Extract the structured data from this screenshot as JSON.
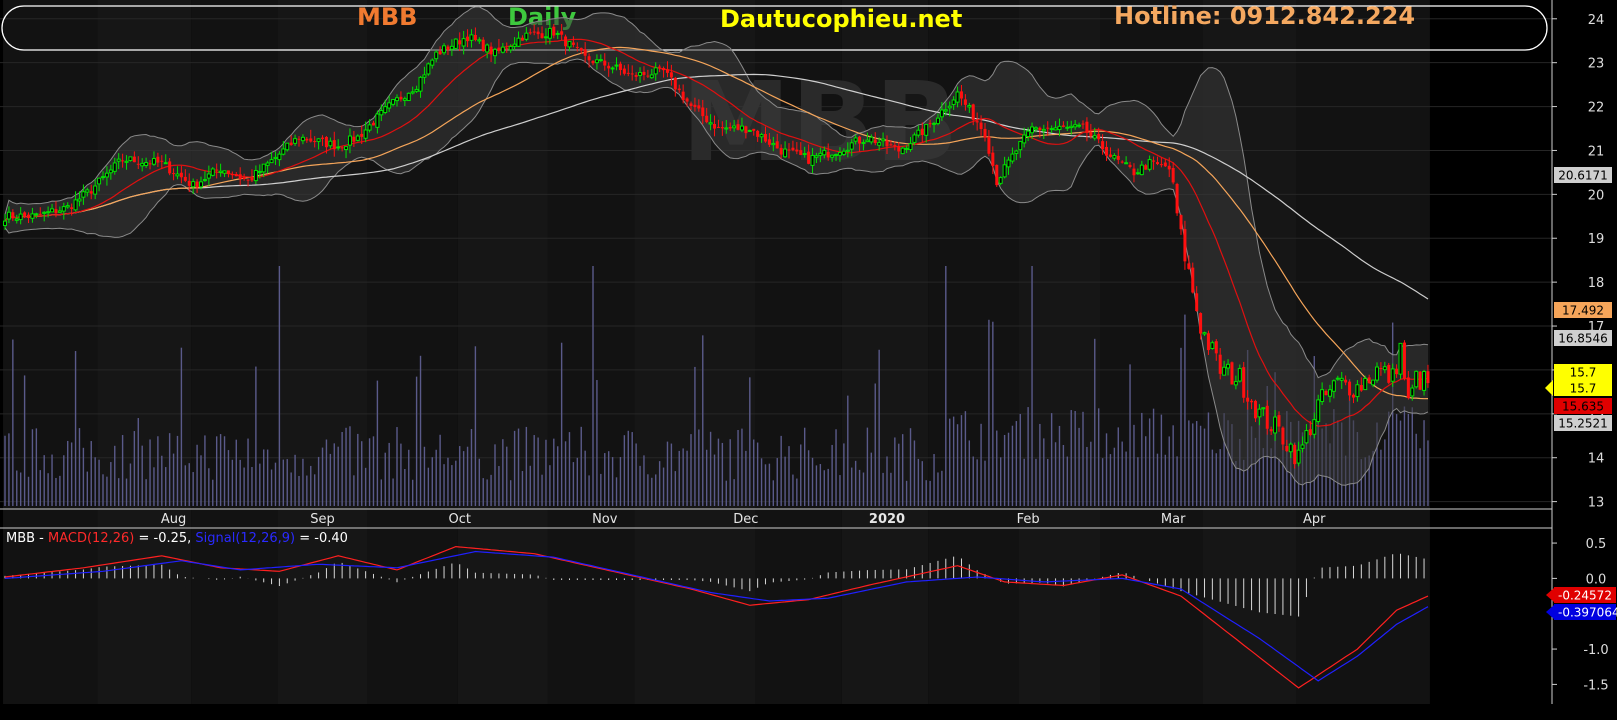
{
  "header": {
    "symbol": "MBB",
    "period": "Daily",
    "site": "Dautucophieu.net",
    "hotline": "Hotline: 0912.842.224",
    "colors": {
      "symbol": "#f07a30",
      "period": "#3ec83e",
      "site": "#ffff00",
      "hotline": "#f4a860"
    }
  },
  "watermark": "MBB",
  "chart_data": [
    {
      "type": "candlestick",
      "ylim": [
        12.9,
        24.2
      ],
      "yticks": [
        13,
        14,
        15,
        16,
        17,
        18,
        19,
        20,
        21,
        22,
        23,
        24
      ],
      "x_labels": [
        "Aug",
        "Sep",
        "Oct",
        "Nov",
        "Dec",
        "2020",
        "Feb",
        "Mar",
        "Apr"
      ],
      "grid": true,
      "price_path": [
        [
          0,
          19.5
        ],
        [
          8,
          19.5
        ],
        [
          16,
          19.7
        ],
        [
          22,
          20.1
        ],
        [
          30,
          20.8
        ],
        [
          40,
          20.7
        ],
        [
          48,
          20.2
        ],
        [
          55,
          20.6
        ],
        [
          62,
          20.3
        ],
        [
          75,
          21.3
        ],
        [
          85,
          21.1
        ],
        [
          90,
          21.3
        ],
        [
          98,
          22.0
        ],
        [
          105,
          22.5
        ],
        [
          110,
          23.2
        ],
        [
          118,
          23.6
        ],
        [
          125,
          23.2
        ],
        [
          132,
          23.6
        ],
        [
          140,
          23.7
        ],
        [
          148,
          23.1
        ],
        [
          155,
          22.9
        ],
        [
          160,
          22.7
        ],
        [
          168,
          22.8
        ],
        [
          175,
          22.0
        ],
        [
          182,
          21.5
        ],
        [
          190,
          21.5
        ],
        [
          198,
          21.0
        ],
        [
          205,
          20.8
        ],
        [
          212,
          21.0
        ],
        [
          220,
          21.3
        ],
        [
          228,
          21.0
        ],
        [
          235,
          21.5
        ],
        [
          243,
          22.3
        ],
        [
          250,
          21.4
        ],
        [
          253,
          20.3
        ],
        [
          258,
          21.0
        ],
        [
          262,
          21.5
        ],
        [
          268,
          21.5
        ],
        [
          275,
          21.5
        ],
        [
          283,
          20.8
        ],
        [
          288,
          20.5
        ],
        [
          292,
          20.7
        ],
        [
          297,
          20.6
        ],
        [
          300,
          19.0
        ],
        [
          305,
          17.0
        ],
        [
          310,
          16.0
        ],
        [
          315,
          15.8
        ],
        [
          320,
          15.0
        ],
        [
          325,
          14.6
        ],
        [
          330,
          14.0
        ],
        [
          335,
          15.2
        ],
        [
          340,
          15.7
        ],
        [
          345,
          15.6
        ],
        [
          350,
          16.0
        ],
        [
          354,
          15.8
        ],
        [
          356,
          16.5
        ],
        [
          358,
          15.2
        ],
        [
          360,
          15.8
        ],
        [
          363,
          15.7
        ]
      ],
      "annotations": [
        {
          "label": "20.6171",
          "color": "#cfcfcf",
          "text_color": "#000"
        },
        {
          "label": "17.492",
          "color": "#f5a55a",
          "text_color": "#000"
        },
        {
          "label": "16.8546",
          "color": "#cfcfcf",
          "text_color": "#000"
        },
        {
          "label": "15.7",
          "color": "#ffff00",
          "text_color": "#000"
        },
        {
          "label": "15.7",
          "color": "#ffff00",
          "text_color": "#000"
        },
        {
          "label": "15.635",
          "color": "#e00000",
          "text_color": "#000"
        },
        {
          "label": "15.2521",
          "color": "#cfcfcf",
          "text_color": "#000"
        }
      ]
    },
    {
      "type": "line",
      "title": "MBB - MACD(12,26) = -0.25, Signal(12,26,9) = -0.40",
      "title_parts": [
        {
          "text": "MBB - ",
          "color": "#ffffff"
        },
        {
          "text": "MACD(12,26)",
          "color": "#ff2a2a"
        },
        {
          "text": " = -0.25, ",
          "color": "#ffffff"
        },
        {
          "text": "Signal(12,26,9)",
          "color": "#2a2aff"
        },
        {
          "text": " = -0.40",
          "color": "#ffffff"
        }
      ],
      "ylim": [
        -1.65,
        0.6
      ],
      "yticks": [
        "0.5",
        "0.0",
        "-0.5",
        "-1.0",
        "-1.5"
      ],
      "series": [
        {
          "name": "MACD(12,26)",
          "color": "#ff2020",
          "values": [
            [
              0,
              0.02
            ],
            [
              20,
              0.15
            ],
            [
              40,
              0.32
            ],
            [
              55,
              0.15
            ],
            [
              70,
              0.1
            ],
            [
              85,
              0.32
            ],
            [
              100,
              0.12
            ],
            [
              115,
              0.45
            ],
            [
              135,
              0.35
            ],
            [
              155,
              0.1
            ],
            [
              175,
              -0.15
            ],
            [
              190,
              -0.38
            ],
            [
              205,
              -0.3
            ],
            [
              220,
              -0.1
            ],
            [
              243,
              0.18
            ],
            [
              255,
              -0.05
            ],
            [
              270,
              -0.1
            ],
            [
              285,
              0.05
            ],
            [
              300,
              -0.25
            ],
            [
              315,
              -0.9
            ],
            [
              330,
              -1.55
            ],
            [
              345,
              -1.0
            ],
            [
              355,
              -0.45
            ],
            [
              363,
              -0.25
            ]
          ]
        },
        {
          "name": "Signal(12,26,9)",
          "color": "#2020ff",
          "values": [
            [
              0,
              0.0
            ],
            [
              25,
              0.1
            ],
            [
              45,
              0.25
            ],
            [
              60,
              0.12
            ],
            [
              80,
              0.2
            ],
            [
              100,
              0.15
            ],
            [
              120,
              0.38
            ],
            [
              140,
              0.3
            ],
            [
              160,
              0.05
            ],
            [
              180,
              -0.2
            ],
            [
              195,
              -0.32
            ],
            [
              210,
              -0.28
            ],
            [
              230,
              -0.05
            ],
            [
              248,
              0.02
            ],
            [
              265,
              -0.05
            ],
            [
              285,
              0.0
            ],
            [
              300,
              -0.15
            ],
            [
              320,
              -0.85
            ],
            [
              335,
              -1.45
            ],
            [
              345,
              -1.1
            ],
            [
              355,
              -0.65
            ],
            [
              363,
              -0.4
            ]
          ]
        }
      ],
      "annotations": [
        {
          "label": "-0.24572",
          "color": "#e00000",
          "text_color": "#fff"
        },
        {
          "label": "-0.397064",
          "color": "#0000e0",
          "text_color": "#fff"
        }
      ]
    }
  ]
}
